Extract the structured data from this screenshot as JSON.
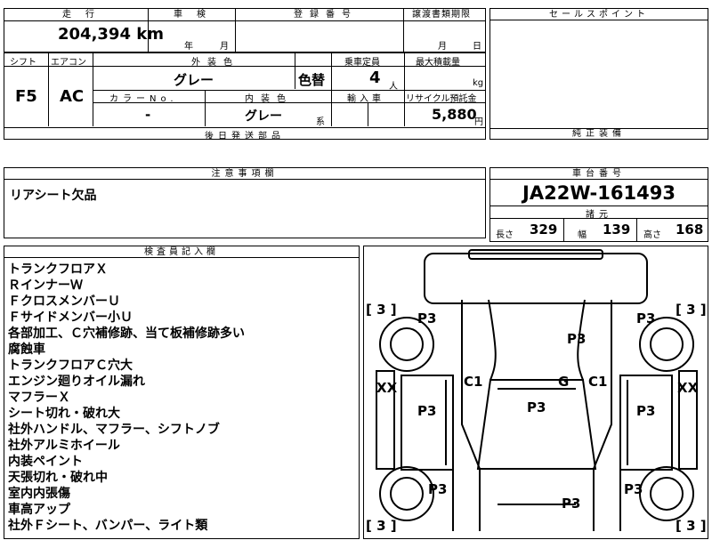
{
  "top_header": {
    "mileage_label": "走行",
    "inspection_label": "車検",
    "registration_label": "登録番号",
    "transfer_deadline_label": "譲渡書類期限",
    "sales_point_label": "セールスポイント"
  },
  "mileage": {
    "value": "204,394",
    "unit": "km"
  },
  "inspection": {
    "year_unit": "年",
    "month_unit": "月"
  },
  "transfer_deadline": {
    "month_unit": "月",
    "day_unit": "日"
  },
  "labels": {
    "shift": "シフト",
    "aircon": "エアコン",
    "exterior_color": "外装色",
    "capacity": "乗車定員",
    "max_load": "最大積載量",
    "color_no": "カラーNo.",
    "interior_color": "内装色",
    "import": "輸入車",
    "recycle": "リサイクル預託金",
    "later_parts": "後日発送部品",
    "genuine_equipment": "純正装備",
    "caution": "注意事項欄",
    "chassis_no_label": "車台番号",
    "specs": "諸元",
    "inspector_notes": "検査員記入欄"
  },
  "specs_row": {
    "shift": "F5",
    "aircon": "AC",
    "exterior_color": "グレー",
    "color_change": "色替",
    "capacity": "4",
    "capacity_unit": "人",
    "load_unit": "kg",
    "color_no": "-",
    "interior_color": "グレー",
    "interior_suffix": "系",
    "recycle_fee": "5,880",
    "recycle_unit": "円"
  },
  "caution_text": "リアシート欠品",
  "chassis_number": "JA22W-161493",
  "dimensions": {
    "length_label": "長さ",
    "length": "329",
    "width_label": "幅",
    "width": "139",
    "height_label": "高さ",
    "height": "168"
  },
  "inspector_notes": [
    "トランクフロアＸ",
    "ＲインナーＷ",
    "ＦクロスメンバーＵ",
    "Ｆサイドメンバー小Ｕ",
    "各部加工、Ｃ穴補修跡、当て板補修跡多い",
    "腐蝕車",
    "トランクフロアＣ穴大",
    "エンジン廻りオイル漏れ",
    "マフラーＸ",
    "シート切れ・破れ大",
    "社外ハンドル、マフラー、シフトノブ",
    "社外アルミホイール",
    "内装ペイント",
    "天張切れ・破れ中",
    "室内内張傷",
    "車高アップ",
    "社外Ｆシート、バンパー、ライト類"
  ],
  "diagram": {
    "tl_bracket": "[ 3 ]",
    "tr_bracket": "[ 3 ]",
    "bl_bracket": "[ 3 ]",
    "br_bracket": "[ 3 ]",
    "p3_fl_tire": "P3",
    "p3_fr_tire": "P3",
    "p3_hood": "P3",
    "p3_front_left": "P3",
    "p3_front_right": "P3",
    "p3_roof": "P3",
    "p3_rl_tire": "P3",
    "p3_rr_tire": "P3",
    "p3_rear": "P3",
    "c1_left": "C1",
    "c1_right": "C1",
    "g_glass": "G",
    "xx_left": "XX",
    "xx_right": "XX"
  }
}
